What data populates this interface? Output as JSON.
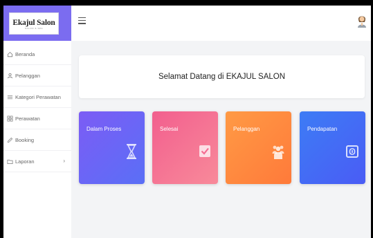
{
  "brand": {
    "title": "Ekajul Salon",
    "subtitle": "SALON & SPA"
  },
  "sidebar": {
    "items": [
      {
        "label": "Beranda",
        "icon": "home-icon"
      },
      {
        "label": "Pelanggan",
        "icon": "user-icon"
      },
      {
        "label": "Kategori Perawatan",
        "icon": "list-icon"
      },
      {
        "label": "Perawatan",
        "icon": "grid-icon"
      },
      {
        "label": "Booking",
        "icon": "pen-icon"
      },
      {
        "label": "Laporan",
        "icon": "folder-icon",
        "chevron": "›"
      }
    ]
  },
  "header": {
    "menu_icon": "hamburger-icon",
    "avatar_icon": "user-avatar-icon"
  },
  "welcome": {
    "text": "Selamat Datang di EKAJUL SALON"
  },
  "cards": [
    {
      "label": "Dalam Proses",
      "icon": "hourglass-icon",
      "color": "#6a63f5"
    },
    {
      "label": "Selesai",
      "icon": "checkbox-icon",
      "color": "#f56b92"
    },
    {
      "label": "Pelanggan",
      "icon": "users-icon",
      "color": "#ff8a3f"
    },
    {
      "label": "Pendapatan",
      "icon": "money-icon",
      "color": "#446df5"
    }
  ]
}
